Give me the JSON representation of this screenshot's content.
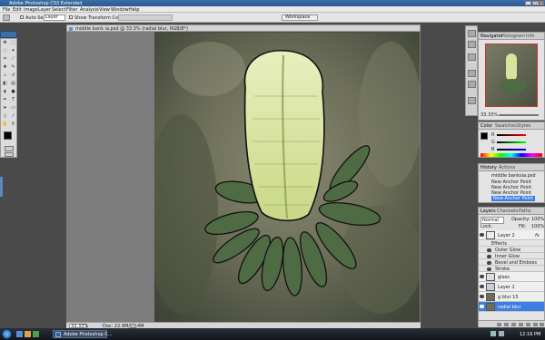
{
  "window": {
    "title": "Adobe Photoshop CS3 Extended"
  },
  "menu": [
    "File",
    "Edit",
    "Image",
    "Layer",
    "Select",
    "Filter",
    "Analysis",
    "View",
    "Window",
    "Help"
  ],
  "options_bar": {
    "auto_select_label": "Auto-Select:",
    "auto_select_value": "Layer",
    "show_transform_label": "Show Transform Controls",
    "workspace_label": "Workspace"
  },
  "document": {
    "tab_label": "middle bank ia.psd @ 33.3% (radial blur, RGB/8*)",
    "zoom": "33.33%",
    "doc_info": "Doc: 22.9M/26.4M"
  },
  "panels": {
    "navigator": {
      "tabs": [
        "Navigator",
        "Histogram",
        "Info"
      ],
      "zoom": "33.33%"
    },
    "color": {
      "tabs": [
        "Color",
        "Swatches",
        "Styles"
      ],
      "channels": [
        "R",
        "G",
        "B"
      ]
    },
    "history": {
      "tabs": [
        "History",
        "Actions"
      ],
      "snapshot": "middle banksia.psd",
      "items": [
        "New Anchor Point",
        "New Anchor Point",
        "New Anchor Point",
        "New Anchor Point"
      ]
    },
    "layers": {
      "tabs": [
        "Layers",
        "Channels",
        "Paths"
      ],
      "blend_mode": "Normal",
      "opacity_label": "Opacity:",
      "opacity_value": "100%",
      "lock_label": "Lock:",
      "fill_label": "Fill:",
      "fill_value": "100%",
      "rows": [
        {
          "name": "Layer 2",
          "fx": "fx"
        },
        {
          "name": "Effects"
        },
        {
          "name": "Outer Glow"
        },
        {
          "name": "Inner Glow"
        },
        {
          "name": "Bevel and Emboss"
        },
        {
          "name": "Stroke"
        },
        {
          "name": "glass"
        },
        {
          "name": "Layer 1"
        },
        {
          "name": "g blur 15"
        },
        {
          "name": "radial blur"
        }
      ]
    }
  },
  "taskbar": {
    "start_label": "",
    "app_button": "Adobe Photoshop C...",
    "clock": "12:16 PM"
  },
  "colors": {
    "selected_layer": "#3d7ee0",
    "accent": "#2a5a90"
  }
}
